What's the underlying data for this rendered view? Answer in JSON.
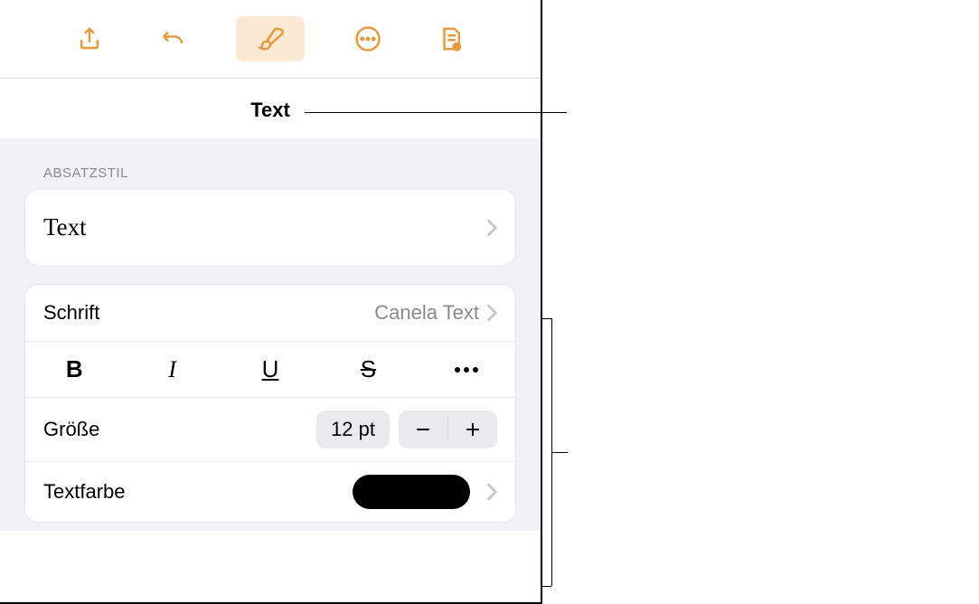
{
  "panel": {
    "title": "Text"
  },
  "paragraph_style": {
    "section_label": "ABSATZSTIL",
    "current": "Text"
  },
  "font": {
    "label": "Schrift",
    "value": "Canela Text"
  },
  "size": {
    "label": "Größe",
    "value": "12 pt"
  },
  "text_color": {
    "label": "Textfarbe",
    "value": "#000000"
  }
}
